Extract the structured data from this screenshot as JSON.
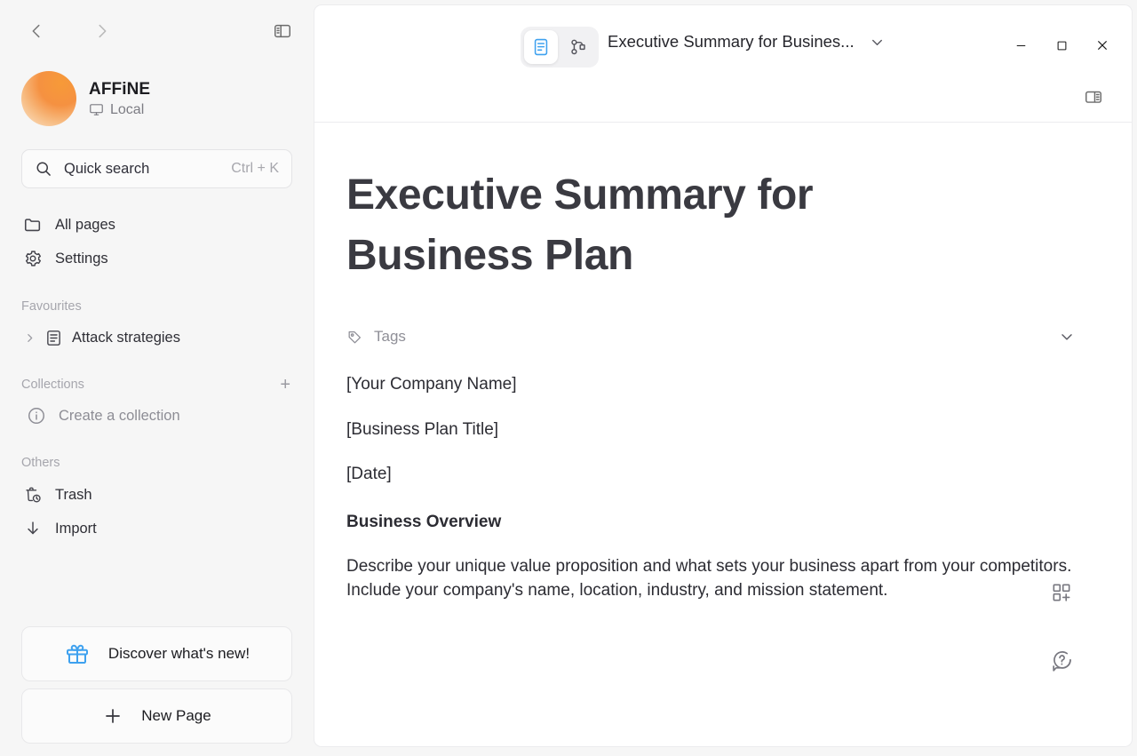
{
  "sidebar": {
    "nav_back_icon": "chevron-left-icon",
    "nav_forward_icon": "chevron-right-icon",
    "panel_toggle_icon": "sidebar-collapse-icon",
    "workspace": {
      "name": "AFFiNE",
      "sub_label": "Local",
      "sub_icon": "monitor-icon"
    },
    "search": {
      "label": "Quick search",
      "shortcut": "Ctrl + K",
      "icon": "search-icon"
    },
    "nav_items": [
      {
        "label": "All pages",
        "icon": "folder-icon"
      },
      {
        "label": "Settings",
        "icon": "gear-icon"
      }
    ],
    "favourites": {
      "title": "Favourites",
      "items": [
        {
          "label": "Attack strategies",
          "icon": "doc-icon",
          "chevron": "chevron-right-icon"
        }
      ]
    },
    "collections": {
      "title": "Collections",
      "add_icon": "plus-icon",
      "empty_label": "Create a collection",
      "empty_icon": "info-icon"
    },
    "others": {
      "title": "Others",
      "items": [
        {
          "label": "Trash",
          "icon": "trash-clock-icon"
        },
        {
          "label": "Import",
          "icon": "arrow-down-icon"
        }
      ]
    },
    "bottom_buttons": [
      {
        "label": "Discover what's new!",
        "icon": "gift-icon",
        "icon_color": "#3ea1ef"
      },
      {
        "label": "New Page",
        "icon": "plus-icon"
      }
    ]
  },
  "titlebar": {
    "mode_page_icon": "page-mode-icon",
    "mode_edgeless_icon": "edgeless-mode-icon",
    "active_mode": "page",
    "doc_title": "Executive Summary for Busines...",
    "doc_title_chevron": "chevron-down-icon",
    "window_controls": {
      "minimize": "minimize-icon",
      "maximize": "maximize-icon",
      "close": "close-icon"
    },
    "right_panel_toggle_icon": "right-sidebar-toggle-icon"
  },
  "document": {
    "title": "Executive Summary for Business Plan",
    "tags": {
      "label": "Tags",
      "icon": "tag-icon",
      "collapse_icon": "chevron-down-icon"
    },
    "blocks": [
      {
        "type": "paragraph",
        "text": "[Your Company Name]"
      },
      {
        "type": "paragraph",
        "text": "[Business Plan Title]"
      },
      {
        "type": "paragraph",
        "text": "[Date]"
      },
      {
        "type": "heading",
        "text": "Business Overview"
      },
      {
        "type": "paragraph",
        "text": "Describe your unique value proposition and what sets your business apart from your competitors. Include your company's name, location, industry, and mission statement."
      }
    ],
    "floating_actions": [
      {
        "icon": "add-block-icon"
      },
      {
        "icon": "help-bubble-icon"
      }
    ]
  },
  "colors": {
    "accent_blue": "#3ea1ef",
    "sidebar_bg": "#f6f6f6",
    "panel_bg": "#ffffff",
    "text_primary": "#2c2c33",
    "text_muted": "#8f8f97"
  }
}
